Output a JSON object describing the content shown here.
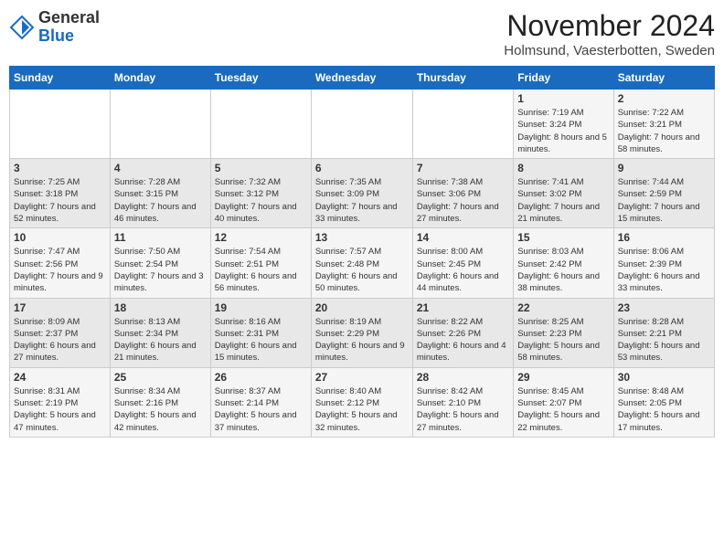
{
  "logo": {
    "general": "General",
    "blue": "Blue"
  },
  "header": {
    "month": "November 2024",
    "location": "Holmsund, Vaesterbotten, Sweden"
  },
  "days_of_week": [
    "Sunday",
    "Monday",
    "Tuesday",
    "Wednesday",
    "Thursday",
    "Friday",
    "Saturday"
  ],
  "weeks": [
    [
      {
        "day": "",
        "info": ""
      },
      {
        "day": "",
        "info": ""
      },
      {
        "day": "",
        "info": ""
      },
      {
        "day": "",
        "info": ""
      },
      {
        "day": "",
        "info": ""
      },
      {
        "day": "1",
        "info": "Sunrise: 7:19 AM\nSunset: 3:24 PM\nDaylight: 8 hours and 5 minutes."
      },
      {
        "day": "2",
        "info": "Sunrise: 7:22 AM\nSunset: 3:21 PM\nDaylight: 7 hours and 58 minutes."
      }
    ],
    [
      {
        "day": "3",
        "info": "Sunrise: 7:25 AM\nSunset: 3:18 PM\nDaylight: 7 hours and 52 minutes."
      },
      {
        "day": "4",
        "info": "Sunrise: 7:28 AM\nSunset: 3:15 PM\nDaylight: 7 hours and 46 minutes."
      },
      {
        "day": "5",
        "info": "Sunrise: 7:32 AM\nSunset: 3:12 PM\nDaylight: 7 hours and 40 minutes."
      },
      {
        "day": "6",
        "info": "Sunrise: 7:35 AM\nSunset: 3:09 PM\nDaylight: 7 hours and 33 minutes."
      },
      {
        "day": "7",
        "info": "Sunrise: 7:38 AM\nSunset: 3:06 PM\nDaylight: 7 hours and 27 minutes."
      },
      {
        "day": "8",
        "info": "Sunrise: 7:41 AM\nSunset: 3:02 PM\nDaylight: 7 hours and 21 minutes."
      },
      {
        "day": "9",
        "info": "Sunrise: 7:44 AM\nSunset: 2:59 PM\nDaylight: 7 hours and 15 minutes."
      }
    ],
    [
      {
        "day": "10",
        "info": "Sunrise: 7:47 AM\nSunset: 2:56 PM\nDaylight: 7 hours and 9 minutes."
      },
      {
        "day": "11",
        "info": "Sunrise: 7:50 AM\nSunset: 2:54 PM\nDaylight: 7 hours and 3 minutes."
      },
      {
        "day": "12",
        "info": "Sunrise: 7:54 AM\nSunset: 2:51 PM\nDaylight: 6 hours and 56 minutes."
      },
      {
        "day": "13",
        "info": "Sunrise: 7:57 AM\nSunset: 2:48 PM\nDaylight: 6 hours and 50 minutes."
      },
      {
        "day": "14",
        "info": "Sunrise: 8:00 AM\nSunset: 2:45 PM\nDaylight: 6 hours and 44 minutes."
      },
      {
        "day": "15",
        "info": "Sunrise: 8:03 AM\nSunset: 2:42 PM\nDaylight: 6 hours and 38 minutes."
      },
      {
        "day": "16",
        "info": "Sunrise: 8:06 AM\nSunset: 2:39 PM\nDaylight: 6 hours and 33 minutes."
      }
    ],
    [
      {
        "day": "17",
        "info": "Sunrise: 8:09 AM\nSunset: 2:37 PM\nDaylight: 6 hours and 27 minutes."
      },
      {
        "day": "18",
        "info": "Sunrise: 8:13 AM\nSunset: 2:34 PM\nDaylight: 6 hours and 21 minutes."
      },
      {
        "day": "19",
        "info": "Sunrise: 8:16 AM\nSunset: 2:31 PM\nDaylight: 6 hours and 15 minutes."
      },
      {
        "day": "20",
        "info": "Sunrise: 8:19 AM\nSunset: 2:29 PM\nDaylight: 6 hours and 9 minutes."
      },
      {
        "day": "21",
        "info": "Sunrise: 8:22 AM\nSunset: 2:26 PM\nDaylight: 6 hours and 4 minutes."
      },
      {
        "day": "22",
        "info": "Sunrise: 8:25 AM\nSunset: 2:23 PM\nDaylight: 5 hours and 58 minutes."
      },
      {
        "day": "23",
        "info": "Sunrise: 8:28 AM\nSunset: 2:21 PM\nDaylight: 5 hours and 53 minutes."
      }
    ],
    [
      {
        "day": "24",
        "info": "Sunrise: 8:31 AM\nSunset: 2:19 PM\nDaylight: 5 hours and 47 minutes."
      },
      {
        "day": "25",
        "info": "Sunrise: 8:34 AM\nSunset: 2:16 PM\nDaylight: 5 hours and 42 minutes."
      },
      {
        "day": "26",
        "info": "Sunrise: 8:37 AM\nSunset: 2:14 PM\nDaylight: 5 hours and 37 minutes."
      },
      {
        "day": "27",
        "info": "Sunrise: 8:40 AM\nSunset: 2:12 PM\nDaylight: 5 hours and 32 minutes."
      },
      {
        "day": "28",
        "info": "Sunrise: 8:42 AM\nSunset: 2:10 PM\nDaylight: 5 hours and 27 minutes."
      },
      {
        "day": "29",
        "info": "Sunrise: 8:45 AM\nSunset: 2:07 PM\nDaylight: 5 hours and 22 minutes."
      },
      {
        "day": "30",
        "info": "Sunrise: 8:48 AM\nSunset: 2:05 PM\nDaylight: 5 hours and 17 minutes."
      }
    ]
  ]
}
